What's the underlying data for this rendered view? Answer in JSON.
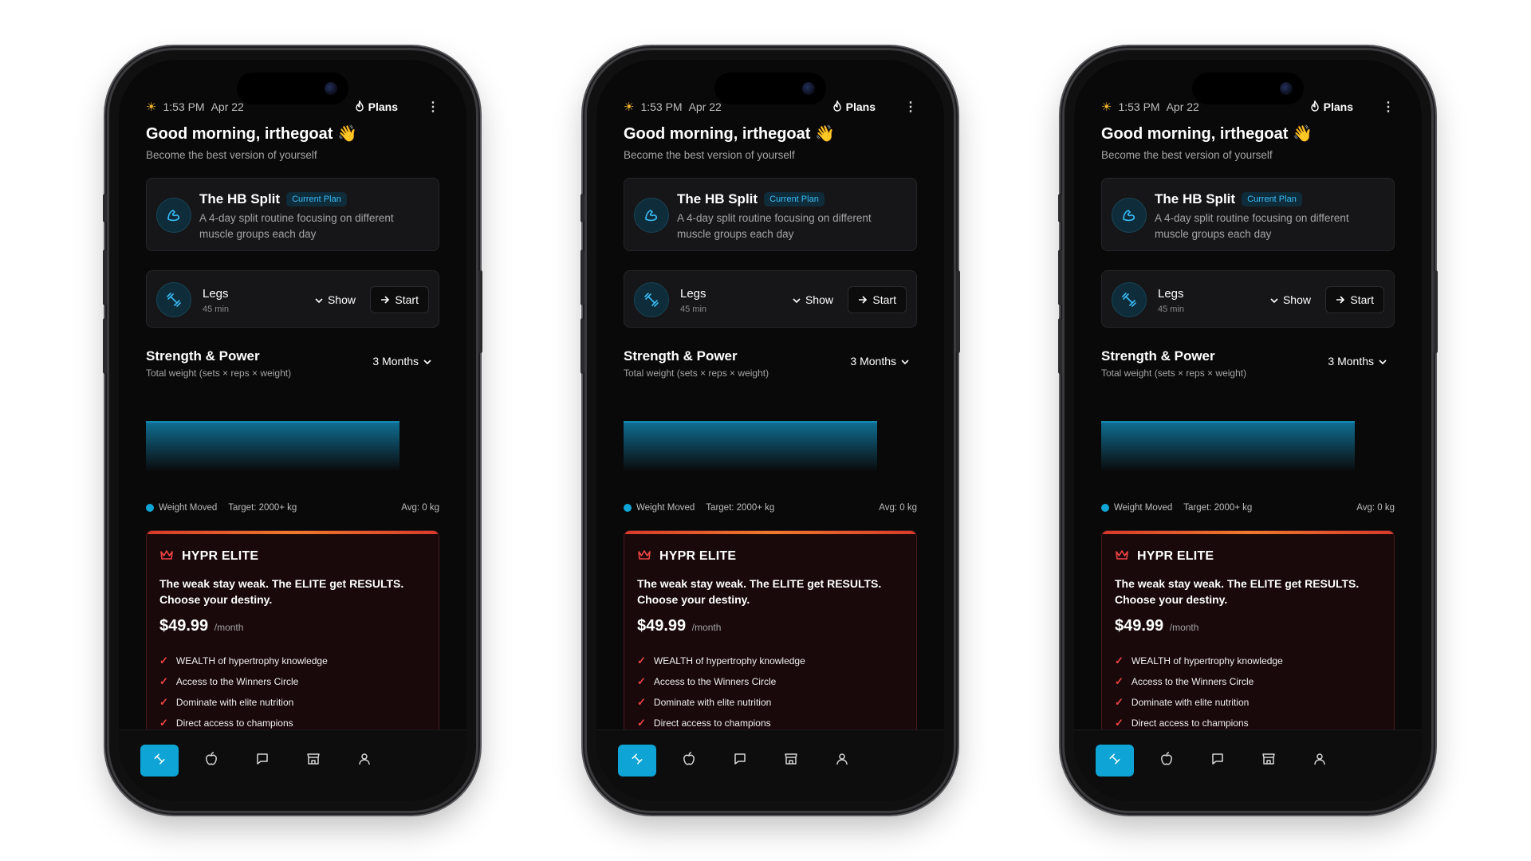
{
  "status": {
    "time": "1:53 PM",
    "date": "Apr 22",
    "plans_label": "Plans"
  },
  "greeting": {
    "title": "Good morning, irthegoat 👋",
    "subtitle": "Become the best version of yourself"
  },
  "plan": {
    "name": "The HB Split",
    "badge": "Current Plan",
    "description": "A 4-day split routine focusing on different muscle groups each day"
  },
  "workout": {
    "name": "Legs",
    "duration": "45 min",
    "show_label": "Show",
    "start_label": "Start"
  },
  "progress": {
    "title": "Strength & Power",
    "subtitle": "Total weight (sets × reps × weight)",
    "range": "3 Months",
    "legend_label": "Weight Moved",
    "target": "Target: 2000+ kg",
    "avg": "Avg: 0 kg"
  },
  "elite": {
    "title": "HYPR ELITE",
    "tagline": "The weak stay weak. The ELITE get RESULTS. Choose your destiny.",
    "price": "$49.99",
    "period": "/month",
    "features": [
      "WEALTH of hypertrophy knowledge",
      "Access to the Winners Circle",
      "Dominate with elite nutrition",
      "Direct access to champions"
    ]
  },
  "tabs": [
    "workouts",
    "nutrition",
    "chat",
    "store",
    "profile"
  ],
  "colors": {
    "accent": "#0ea5d6",
    "elite_red": "#ef4444",
    "background": "#09090a"
  },
  "chart_data": {
    "type": "area",
    "series": [
      {
        "name": "Weight Moved",
        "values": [
          0,
          0
        ]
      }
    ],
    "y_values_note": "",
    "legend": [
      "Weight Moved"
    ]
  }
}
